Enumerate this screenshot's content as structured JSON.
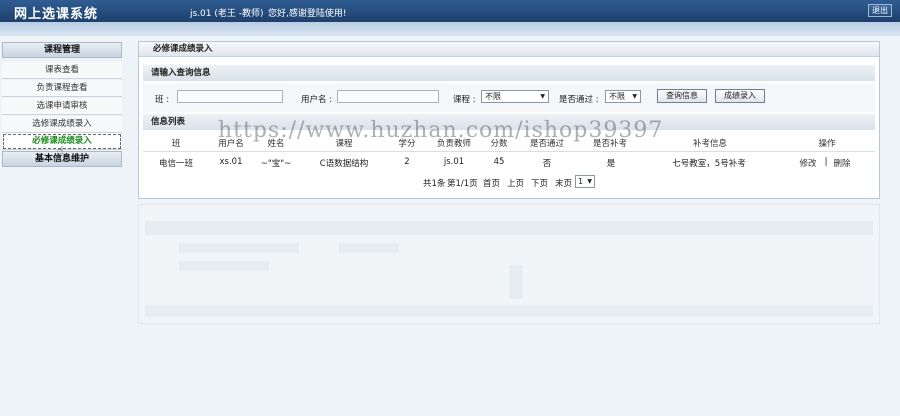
{
  "header": {
    "app_title": "网上选课系统",
    "user": "js.01 (老王 -教师)",
    "greeting": "您好,感谢登陆使用!",
    "logout": "退出"
  },
  "sidebar": {
    "group1": "课程管理",
    "items": [
      {
        "label": "课表查看"
      },
      {
        "label": "负责课程查看"
      },
      {
        "label": "选课申请审核"
      },
      {
        "label": "选修课成绩录入"
      },
      {
        "label": "必修课成绩录入"
      }
    ],
    "group2": "基本信息维护"
  },
  "main": {
    "panel_title": "必修课成绩录入",
    "query_title": "请输入查询信息",
    "query": {
      "class_label": "班 :",
      "user_label": "用户名 :",
      "course_label": "课程 :",
      "course_value": "不限",
      "passed_label": "是否通过 :",
      "passed_value": "不限",
      "search_button": "查询信息",
      "score_button": "成绩录入"
    },
    "list_title": "信息列表",
    "columns": [
      "班",
      "用户名",
      "姓名",
      "课程",
      "学分",
      "负责教师",
      "分数",
      "是否通过",
      "是否补考",
      "补考信息",
      "操作"
    ],
    "row": {
      "class": "电信一班",
      "username": "xs.01",
      "name": "~\"宝\"~",
      "course": "C语数据结构",
      "credit": "2",
      "teacher": "js.01",
      "score": "45",
      "passed": "否",
      "retake": "是",
      "retake_info": "七号教室，5号补考",
      "edit": "修改",
      "sep": "|",
      "delete": "删除"
    },
    "pager": {
      "total": "共1条",
      "page": "第1/1页",
      "first": "首页",
      "prev": "上页",
      "next": "下页",
      "last": "末页",
      "current": "1"
    }
  },
  "watermark": "https://www.huzhan.com/ishop39397"
}
